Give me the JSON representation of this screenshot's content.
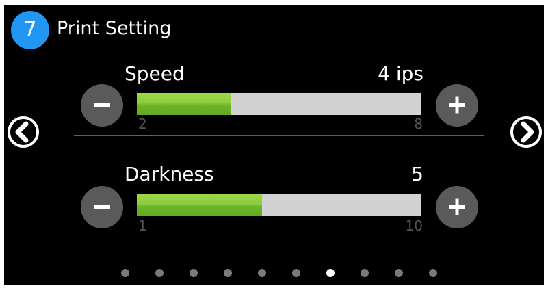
{
  "header": {
    "step_number": "7",
    "title": "Print Setting"
  },
  "nav": {
    "prev_icon": "chevron-left-circle-icon",
    "next_icon": "chevron-right-circle-icon"
  },
  "settings": [
    {
      "id": "speed",
      "label": "Speed",
      "value_text": "4 ips",
      "min_label": "2",
      "max_label": "8",
      "fill_fraction": 0.33
    },
    {
      "id": "darkness",
      "label": "Darkness",
      "value_text": "5",
      "min_label": "1",
      "max_label": "10",
      "fill_fraction": 0.44
    }
  ],
  "pagination": {
    "total_pages": 10,
    "active_index": 6
  },
  "colors": {
    "badge": "#2196f3",
    "fill": "#7cc134",
    "track": "#d2d2d2",
    "button": "#5a5a5a",
    "divider": "#3d6b86",
    "dot": "#7a7a7a",
    "dot_active": "#ffffff"
  }
}
